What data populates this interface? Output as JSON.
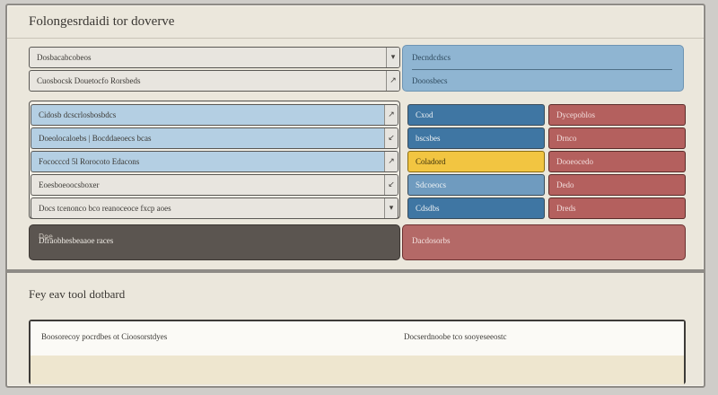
{
  "window": {
    "title": "Folongesrdaidi tor doverve"
  },
  "top": {
    "rows": [
      {
        "text": "Dosbacabcobeos",
        "icon": "▾"
      },
      {
        "text": "Cuosbocsk Douetocfo Rorsbeds",
        "icon": "↗"
      }
    ],
    "blue_card": {
      "title": "Decndcdscs",
      "subtitle": "Dooosbecs"
    }
  },
  "table": {
    "rows": [
      {
        "left": "Cidosb dcscrlosbosbdcs",
        "left_icon": "↗",
        "mid": "Cxod",
        "right": "Dycepoblos"
      },
      {
        "left": "Doeolocaloebs | Bocddaeoecs bcas",
        "left_icon": "↙",
        "mid": "bscsbes",
        "right": "Drnco"
      },
      {
        "left": "Fococccd 5l Rorocoto Edacons",
        "left_icon": "↗",
        "mid": "Coladord",
        "right": "Dooeocedo"
      },
      {
        "left": "Eoesboeoocsboxer",
        "left_icon": "↙",
        "mid": "Sdcoeocs",
        "right": "Dedo"
      },
      {
        "left": "Docs tcenonco bco reanoceoce fxcp aoes",
        "left_icon": "▾",
        "mid": "Cdsdbs",
        "right": "Dreds"
      }
    ],
    "dark_row": {
      "text": "Dfraobhesbeaaoe races",
      "mark": "Doe"
    },
    "red_big": {
      "text": "Dacdosorbs"
    }
  },
  "section2": {
    "title": "Fey eav tool dotbard",
    "left_text": "Boosorecoy pocrdbes ot Cioosorstdyes",
    "right_text": "Docserdnoobe tco sooyeseeostc"
  }
}
